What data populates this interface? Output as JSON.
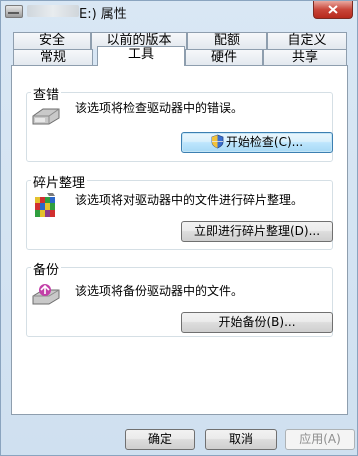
{
  "window": {
    "title_suffix": "E:) 属性"
  },
  "tabs_row1": [
    "安全",
    "以前的版本",
    "配额",
    "自定义"
  ],
  "tabs_row2": [
    "常规",
    "工具",
    "硬件",
    "共享"
  ],
  "active_tab": "工具",
  "groups": {
    "check": {
      "title": "查错",
      "description": "该选项将检查驱动器中的错误。",
      "button": "开始检查(C)..."
    },
    "defrag": {
      "title": "碎片整理",
      "description": "该选项将对驱动器中的文件进行碎片整理。",
      "button": "立即进行碎片整理(D)..."
    },
    "backup": {
      "title": "备份",
      "description": "该选项将备份驱动器中的文件。",
      "button": "开始备份(B)..."
    }
  },
  "footer": {
    "ok": "确定",
    "cancel": "取消",
    "apply": "应用(A)"
  },
  "icons": {
    "drive": "drive-icon",
    "shield": "uac-shield-icon",
    "defrag": "defrag-icon",
    "backup": "backup-icon"
  }
}
